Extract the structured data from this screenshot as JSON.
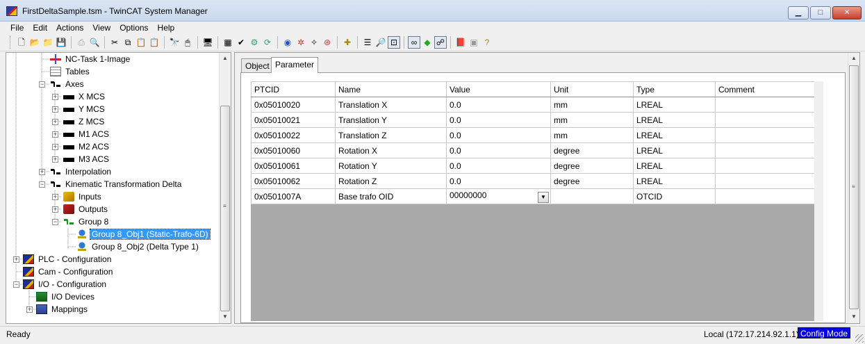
{
  "window": {
    "title": "FirstDeltaSample.tsm - TwinCAT System Manager",
    "buttons": [
      "minimize-icon",
      "maximize-icon",
      "close-icon"
    ]
  },
  "menu": [
    "File",
    "Edit",
    "Actions",
    "View",
    "Options",
    "Help"
  ],
  "toolbar_icons": [
    "new-icon",
    "open-icon",
    "open-folder-icon",
    "save-icon",
    "print-icon",
    "print-preview-icon",
    "cut-icon",
    "copy-icon",
    "paste-icon",
    "paste-special-icon",
    "find-icon",
    "mouse-icon",
    "monitor-icon",
    "generate-mappings-icon",
    "check-icon",
    "activate-icon",
    "restart-icon",
    "login-icon",
    "network-scan-icon",
    "wand-icon",
    "toggle-icon",
    "add-icon",
    "list-icon",
    "zoom-icon",
    "online-watch-icon",
    "goggles-icon",
    "show-online-icon",
    "free-run-icon",
    "book-icon",
    "info-icon",
    "help-icon"
  ],
  "tree": {
    "items": [
      {
        "label": "NC-Task 1-Image",
        "icon": "nc-image-icon"
      },
      {
        "label": "Tables",
        "icon": "table-icon"
      },
      {
        "label": "Axes",
        "icon": "axes-folder-icon"
      },
      {
        "label": "X MCS",
        "icon": "axis-icon"
      },
      {
        "label": "Y MCS",
        "icon": "axis-icon"
      },
      {
        "label": "Z MCS",
        "icon": "axis-icon"
      },
      {
        "label": "M1 ACS",
        "icon": "axis-icon"
      },
      {
        "label": "M2 ACS",
        "icon": "axis-icon"
      },
      {
        "label": "M3 ACS",
        "icon": "axis-icon"
      },
      {
        "label": "Interpolation",
        "icon": "interpolation-icon"
      },
      {
        "label": "Kinematic Transformation Delta",
        "icon": "kinematic-icon"
      },
      {
        "label": "Inputs",
        "icon": "inputs-icon"
      },
      {
        "label": "Outputs",
        "icon": "outputs-icon"
      },
      {
        "label": "Group 8",
        "icon": "group-icon"
      },
      {
        "label": "Group 8_Obj1 (Static-Trafo-6D)",
        "icon": "object-icon"
      },
      {
        "label": "Group 8_Obj2 (Delta Type 1)",
        "icon": "object-icon"
      },
      {
        "label": "PLC - Configuration",
        "icon": "plc-icon"
      },
      {
        "label": "Cam - Configuration",
        "icon": "cam-icon"
      },
      {
        "label": "I/O - Configuration",
        "icon": "io-icon"
      },
      {
        "label": "I/O Devices",
        "icon": "io-devices-icon"
      },
      {
        "label": "Mappings",
        "icon": "mappings-icon"
      }
    ]
  },
  "tabs": [
    {
      "label": "Object"
    },
    {
      "label": "Parameter"
    }
  ],
  "table": {
    "columns": [
      "PTCID",
      "Name",
      "Value",
      "Unit",
      "Type",
      "Comment"
    ],
    "rows": [
      [
        "0x05010020",
        "Translation X",
        "0.0",
        "mm",
        "LREAL",
        ""
      ],
      [
        "0x05010021",
        "Translation Y",
        "0.0",
        "mm",
        "LREAL",
        ""
      ],
      [
        "0x05010022",
        "Translation Z",
        "0.0",
        "mm",
        "LREAL",
        ""
      ],
      [
        "0x05010060",
        "Rotation X",
        "0.0",
        "degree",
        "LREAL",
        ""
      ],
      [
        "0x05010061",
        "Rotation Y",
        "0.0",
        "degree",
        "LREAL",
        ""
      ],
      [
        "0x05010062",
        "Rotation Z",
        "0.0",
        "degree",
        "LREAL",
        ""
      ],
      [
        "0x0501007A",
        "Base trafo OID",
        "00000000",
        "",
        "OTCID",
        ""
      ]
    ]
  },
  "status": {
    "text": "Ready",
    "connection": "Local (172.17.214.92.1.1)",
    "mode": "Config Mode"
  },
  "colors": {
    "selection": "#3399ff",
    "config_mode_bg": "#0000e0",
    "grid_background": "#a9a9a9"
  }
}
